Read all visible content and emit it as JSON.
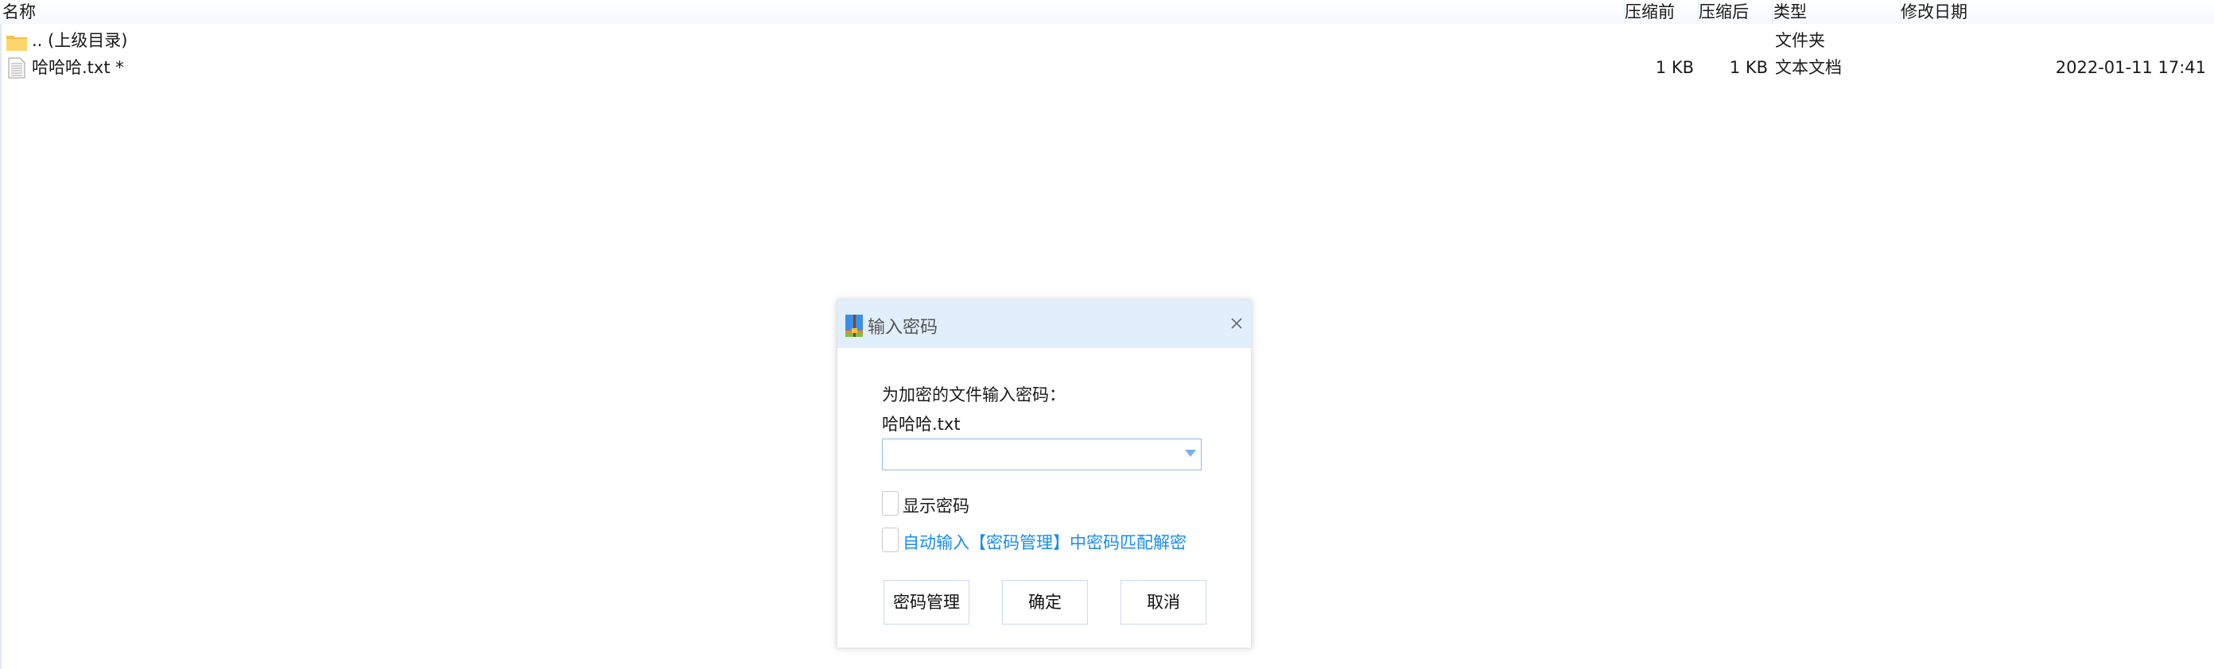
{
  "columns": {
    "name": "名称",
    "before": "压缩前",
    "after": "压缩后",
    "type": "类型",
    "modified": "修改日期"
  },
  "rows": [
    {
      "name": ".. (上级目录)",
      "before": "",
      "after": "",
      "type": "文件夹",
      "modified": "",
      "icon": "folder-icon"
    },
    {
      "name": "哈哈哈.txt *",
      "before": "1 KB",
      "after": "1 KB",
      "type": "文本文档",
      "modified": "2022-01-11 17:41",
      "icon": "text-file-icon"
    }
  ],
  "dialog": {
    "title": "输入密码",
    "prompt": "为加密的文件输入密码：",
    "filename": "哈哈哈.txt",
    "password_value": "",
    "show_password_label": "显示密码",
    "auto_fill_label": "自动输入【密码管理】中密码匹配解密",
    "buttons": {
      "manage": "密码管理",
      "ok": "确定",
      "cancel": "取消"
    },
    "link_color": "#1a8cf0"
  }
}
